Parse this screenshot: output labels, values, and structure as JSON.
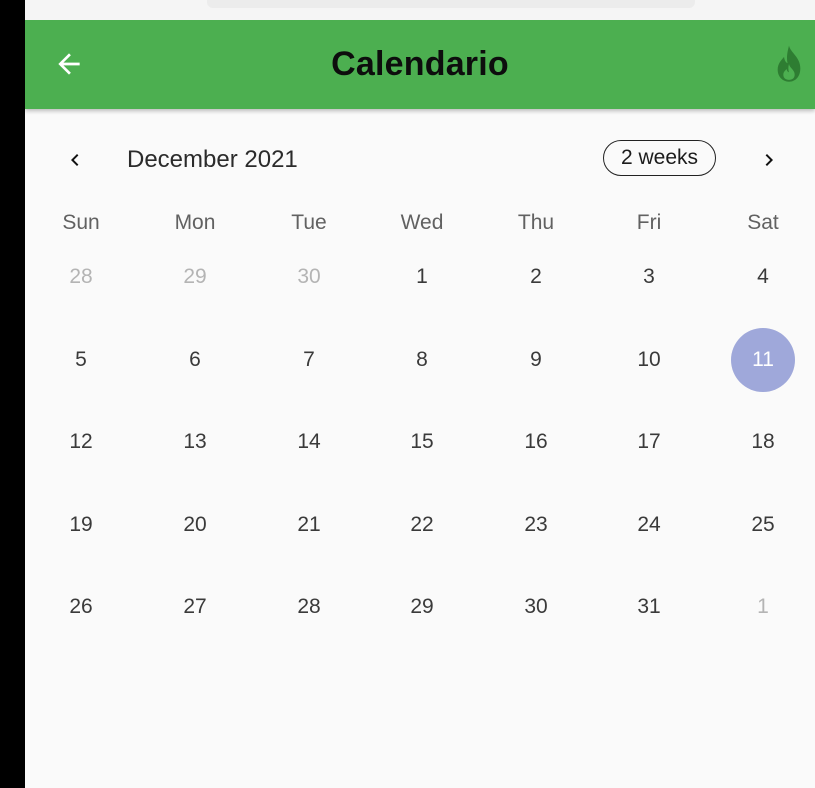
{
  "app": {
    "title": "Calendario",
    "accent_color": "#4caf50",
    "today_color": "#9fa8da"
  },
  "calendar": {
    "month_label": "December 2021",
    "format_button": "2 weeks",
    "prev_icon": "chevron-left-icon",
    "next_icon": "chevron-right-icon",
    "weekdays": [
      "Sun",
      "Mon",
      "Tue",
      "Wed",
      "Thu",
      "Fri",
      "Sat"
    ],
    "weeks": [
      [
        {
          "day": "28",
          "outside": true
        },
        {
          "day": "29",
          "outside": true
        },
        {
          "day": "30",
          "outside": true
        },
        {
          "day": "1"
        },
        {
          "day": "2"
        },
        {
          "day": "3"
        },
        {
          "day": "4"
        }
      ],
      [
        {
          "day": "5"
        },
        {
          "day": "6"
        },
        {
          "day": "7"
        },
        {
          "day": "8"
        },
        {
          "day": "9"
        },
        {
          "day": "10"
        },
        {
          "day": "11",
          "today": true
        }
      ],
      [
        {
          "day": "12"
        },
        {
          "day": "13"
        },
        {
          "day": "14"
        },
        {
          "day": "15"
        },
        {
          "day": "16"
        },
        {
          "day": "17"
        },
        {
          "day": "18"
        }
      ],
      [
        {
          "day": "19"
        },
        {
          "day": "20"
        },
        {
          "day": "21"
        },
        {
          "day": "22"
        },
        {
          "day": "23"
        },
        {
          "day": "24"
        },
        {
          "day": "25"
        }
      ],
      [
        {
          "day": "26"
        },
        {
          "day": "27"
        },
        {
          "day": "28"
        },
        {
          "day": "29"
        },
        {
          "day": "30"
        },
        {
          "day": "31"
        },
        {
          "day": "1",
          "outside": true
        }
      ]
    ]
  }
}
